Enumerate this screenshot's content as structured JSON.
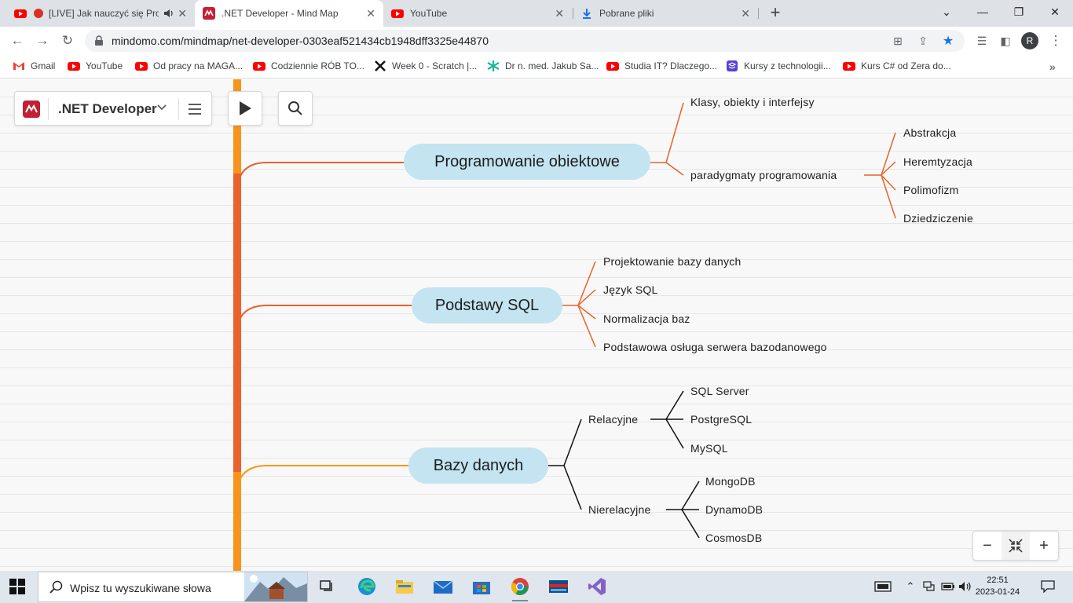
{
  "browser": {
    "tabs": [
      {
        "title": "[LIVE] Jak nauczyć się Pro",
        "favicon": "youtube-icon",
        "audio": true
      },
      {
        "title": ".NET Developer - Mind Map",
        "favicon": "mindomo-icon",
        "active": true
      },
      {
        "title": "YouTube",
        "favicon": "youtube-icon"
      },
      {
        "title": "Pobrane pliki",
        "favicon": "download-icon"
      }
    ],
    "url": "mindomo.com/mindmap/net-developer-0303eaf521434cb1948dff3325e44870",
    "avatar_letter": "R",
    "bookmarks": [
      {
        "label": "Gmail",
        "icon": "gmail-icon"
      },
      {
        "label": "YouTube",
        "icon": "youtube-icon"
      },
      {
        "label": "Od pracy na MAGA...",
        "icon": "youtube-icon"
      },
      {
        "label": "Codziennie RÓB TO...",
        "icon": "youtube-icon"
      },
      {
        "label": "Week 0 - Scratch |...",
        "icon": "x-icon"
      },
      {
        "label": "Dr n. med. Jakub Sa...",
        "icon": "star-icon"
      },
      {
        "label": "Studia IT? Dlaczego...",
        "icon": "youtube-icon"
      },
      {
        "label": "Kursy z technologii...",
        "icon": "course-icon"
      },
      {
        "label": "Kurs C# od Zera do...",
        "icon": "youtube-icon"
      }
    ]
  },
  "mindmap": {
    "title": ".NET Developer",
    "colors": {
      "branch1": "#e8622c",
      "branch2": "#e8622c",
      "branch3": "#f39a13",
      "spine": "#f7941d",
      "topic_bg": "#c3e4f0"
    },
    "topics": [
      {
        "label": "Programowanie obiektowe",
        "children": [
          {
            "label": "Klasy, obiekty i interfejsy",
            "children": []
          },
          {
            "label": "paradygmaty programowania",
            "children": [
              "Abstrakcja",
              "Heremtyzacja",
              "Polimofizm",
              "Dziedziczenie"
            ]
          }
        ]
      },
      {
        "label": "Podstawy SQL",
        "children": [
          {
            "label": "Projektowanie bazy danych"
          },
          {
            "label": "Język SQL"
          },
          {
            "label": "Normalizacja baz"
          },
          {
            "label": "Podstawowa osługa serwera bazodanowego"
          }
        ]
      },
      {
        "label": "Bazy danych",
        "children": [
          {
            "label": "Relacyjne",
            "children": [
              "SQL Server",
              "PostgreSQL",
              "MySQL"
            ]
          },
          {
            "label": "Nierelacyjne",
            "children": [
              "MongoDB",
              "DynamoDB",
              "CosmosDB"
            ]
          }
        ]
      }
    ]
  },
  "taskbar": {
    "search_placeholder": "Wpisz tu wyszukiwane słowa",
    "time": "22:51",
    "date": "2023-01-24"
  }
}
